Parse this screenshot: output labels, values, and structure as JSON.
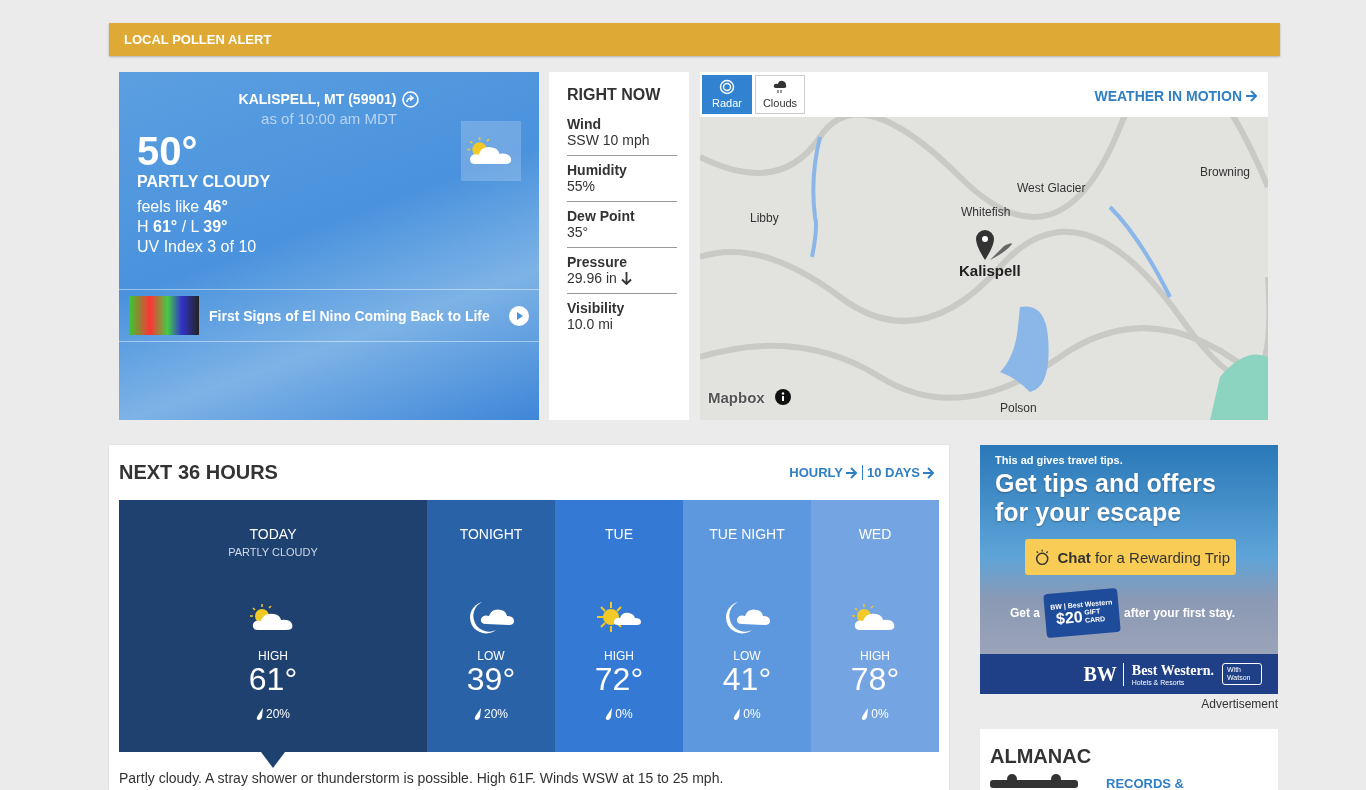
{
  "alert": {
    "label": "LOCAL POLLEN ALERT"
  },
  "current": {
    "location": "KALISPELL, MT (59901)",
    "as_of": "as of 10:00 am MDT",
    "temp": "50°",
    "condition": "PARTLY CLOUDY",
    "feels_like": "feels like **46°**",
    "high_low": "H **61°** / L **39°**",
    "uv": "UV Index 3 of 10",
    "video": {
      "title": "First Signs of El Nino Coming Back to Life"
    }
  },
  "right_now": {
    "title": "RIGHT NOW",
    "items": [
      {
        "label": "Wind",
        "value": "SSW 10 mph",
        "falling": false
      },
      {
        "label": "Humidity",
        "value": "55%",
        "falling": false
      },
      {
        "label": "Dew Point",
        "value": "35°",
        "falling": false
      },
      {
        "label": "Pressure",
        "value": "29.96 in",
        "falling": true
      },
      {
        "label": "Visibility",
        "value": "10.0 mi",
        "falling": false
      }
    ]
  },
  "map": {
    "tabs": [
      {
        "label": "Radar",
        "selected": true
      },
      {
        "label": "Clouds",
        "selected": false
      }
    ],
    "link": "WEATHER IN MOTION",
    "places": [
      {
        "name": "Browning",
        "kind": "town"
      },
      {
        "name": "West Glacier",
        "kind": "town"
      },
      {
        "name": "Whitefish",
        "kind": "town"
      },
      {
        "name": "Libby",
        "kind": "town"
      },
      {
        "name": "Kalispell",
        "kind": "marker"
      },
      {
        "name": "Polson",
        "kind": "town"
      }
    ],
    "attribution": "Mapbox"
  },
  "next_36": {
    "title": "NEXT 36 HOURS",
    "links": [
      "HOURLY",
      "10 DAYS"
    ],
    "periods": [
      {
        "name": "TODAY",
        "condition": "PARTLY CLOUDY",
        "kind": "day",
        "label": "HIGH",
        "temp": "61°",
        "precip": "20%",
        "selected": true,
        "color": "#1f416f"
      },
      {
        "name": "TONIGHT",
        "kind": "night",
        "label": "LOW",
        "temp": "39°",
        "precip": "20%",
        "selected": false,
        "color": "#2a62a8"
      },
      {
        "name": "TUE",
        "kind": "sunny",
        "label": "HIGH",
        "temp": "72°",
        "precip": "0%",
        "selected": false,
        "color": "#3479d4"
      },
      {
        "name": "TUE NIGHT",
        "kind": "night",
        "label": "LOW",
        "temp": "41°",
        "precip": "0%",
        "selected": false,
        "color": "#5d97de"
      },
      {
        "name": "WED",
        "kind": "day",
        "label": "HIGH",
        "temp": "78°",
        "precip": "0%",
        "selected": false,
        "color": "#74a5e2"
      }
    ],
    "summary": "Partly cloudy. A stray shower or thunderstorm is possible. High 61F. Winds WSW at 15 to 25 mph."
  },
  "ad": {
    "tagline": "This ad gives travel tips.",
    "headline": "Get tips and offers for your escape",
    "button": "**Chat** for a Rewarding Trip",
    "offer_before": "Get a",
    "card_brand": "BW | Best Western",
    "card_amount": "$20",
    "card_text": "GIFT CARD",
    "offer_after": "after your first stay.",
    "logo": "BW",
    "brand": "Best Western.",
    "brand_sub": "Hotels & Resorts",
    "partner": "With Watson",
    "label": "Advertisement"
  },
  "almanac": {
    "title": "ALMANAC",
    "link": "RECORDS &"
  }
}
